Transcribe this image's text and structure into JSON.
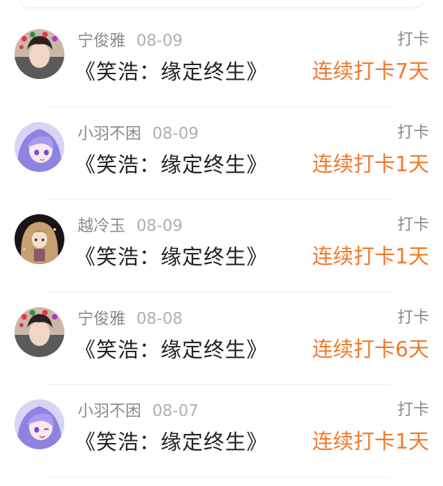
{
  "entries": [
    {
      "user": "宁俊雅",
      "date": "08-09",
      "tag": "打卡",
      "title": "《笑浩：缘定终生》",
      "streak": "连续打卡7天",
      "avatar": "boy-hearts-avatar-icon"
    },
    {
      "user": "小羽不困",
      "date": "08-09",
      "tag": "打卡",
      "title": "《笑浩：缘定终生》",
      "streak": "连续打卡1天",
      "avatar": "anime-purple-hair-avatar-icon"
    },
    {
      "user": "越冷玉",
      "date": "08-09",
      "tag": "打卡",
      "title": "《笑浩：缘定终生》",
      "streak": "连续打卡1天",
      "avatar": "anime-golden-hair-avatar-icon"
    },
    {
      "user": "宁俊雅",
      "date": "08-08",
      "tag": "打卡",
      "title": "《笑浩：缘定终生》",
      "streak": "连续打卡6天",
      "avatar": "boy-hearts-avatar-icon"
    },
    {
      "user": "小羽不困",
      "date": "08-07",
      "tag": "打卡",
      "title": "《笑浩：缘定终生》",
      "streak": "连续打卡1天",
      "avatar": "anime-purple-hair-avatar-icon"
    }
  ],
  "colors": {
    "streak": "#f07a2a",
    "muted": "#8a8a8a",
    "title": "#222222"
  }
}
